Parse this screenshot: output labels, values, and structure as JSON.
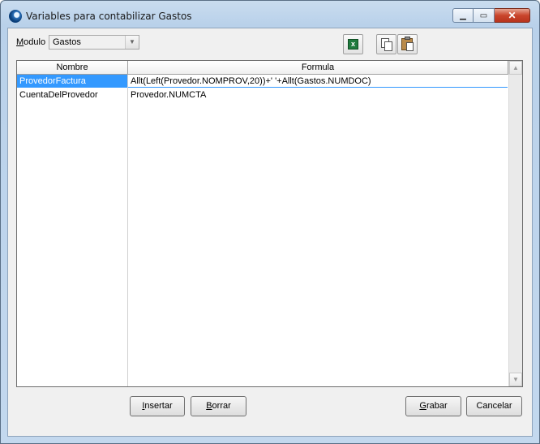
{
  "window": {
    "title": "Variables para contabilizar Gastos",
    "minimize_symbol": "▁",
    "maximize_symbol": "▭",
    "close_symbol": "✕"
  },
  "modulo": {
    "label_mnemonic": "M",
    "label_rest": "odulo",
    "selected_value": "Gastos",
    "arrow_symbol": "▼"
  },
  "toolbar": {
    "excel_symbol": "x",
    "icons": [
      "excel-icon",
      "copy-icon",
      "paste-icon"
    ]
  },
  "grid": {
    "columns": [
      "Nombre",
      "Formula"
    ],
    "rows": [
      {
        "nombre": "ProvedorFactura",
        "formula": "Allt(Left(Provedor.NOMPROV,20))+' '+Allt(Gastos.NUMDOC)"
      },
      {
        "nombre": "CuentaDelProvedor",
        "formula": "Provedor.NUMCTA"
      }
    ],
    "scroll_up_symbol": "▲",
    "scroll_down_symbol": "▼"
  },
  "buttons": {
    "insertar": {
      "mnemonic": "I",
      "rest": "nsertar"
    },
    "borrar": {
      "mnemonic": "B",
      "rest": "orrar"
    },
    "grabar": {
      "mnemonic": "G",
      "rest": "rabar"
    },
    "cancelar": {
      "label": "Cancelar"
    }
  }
}
